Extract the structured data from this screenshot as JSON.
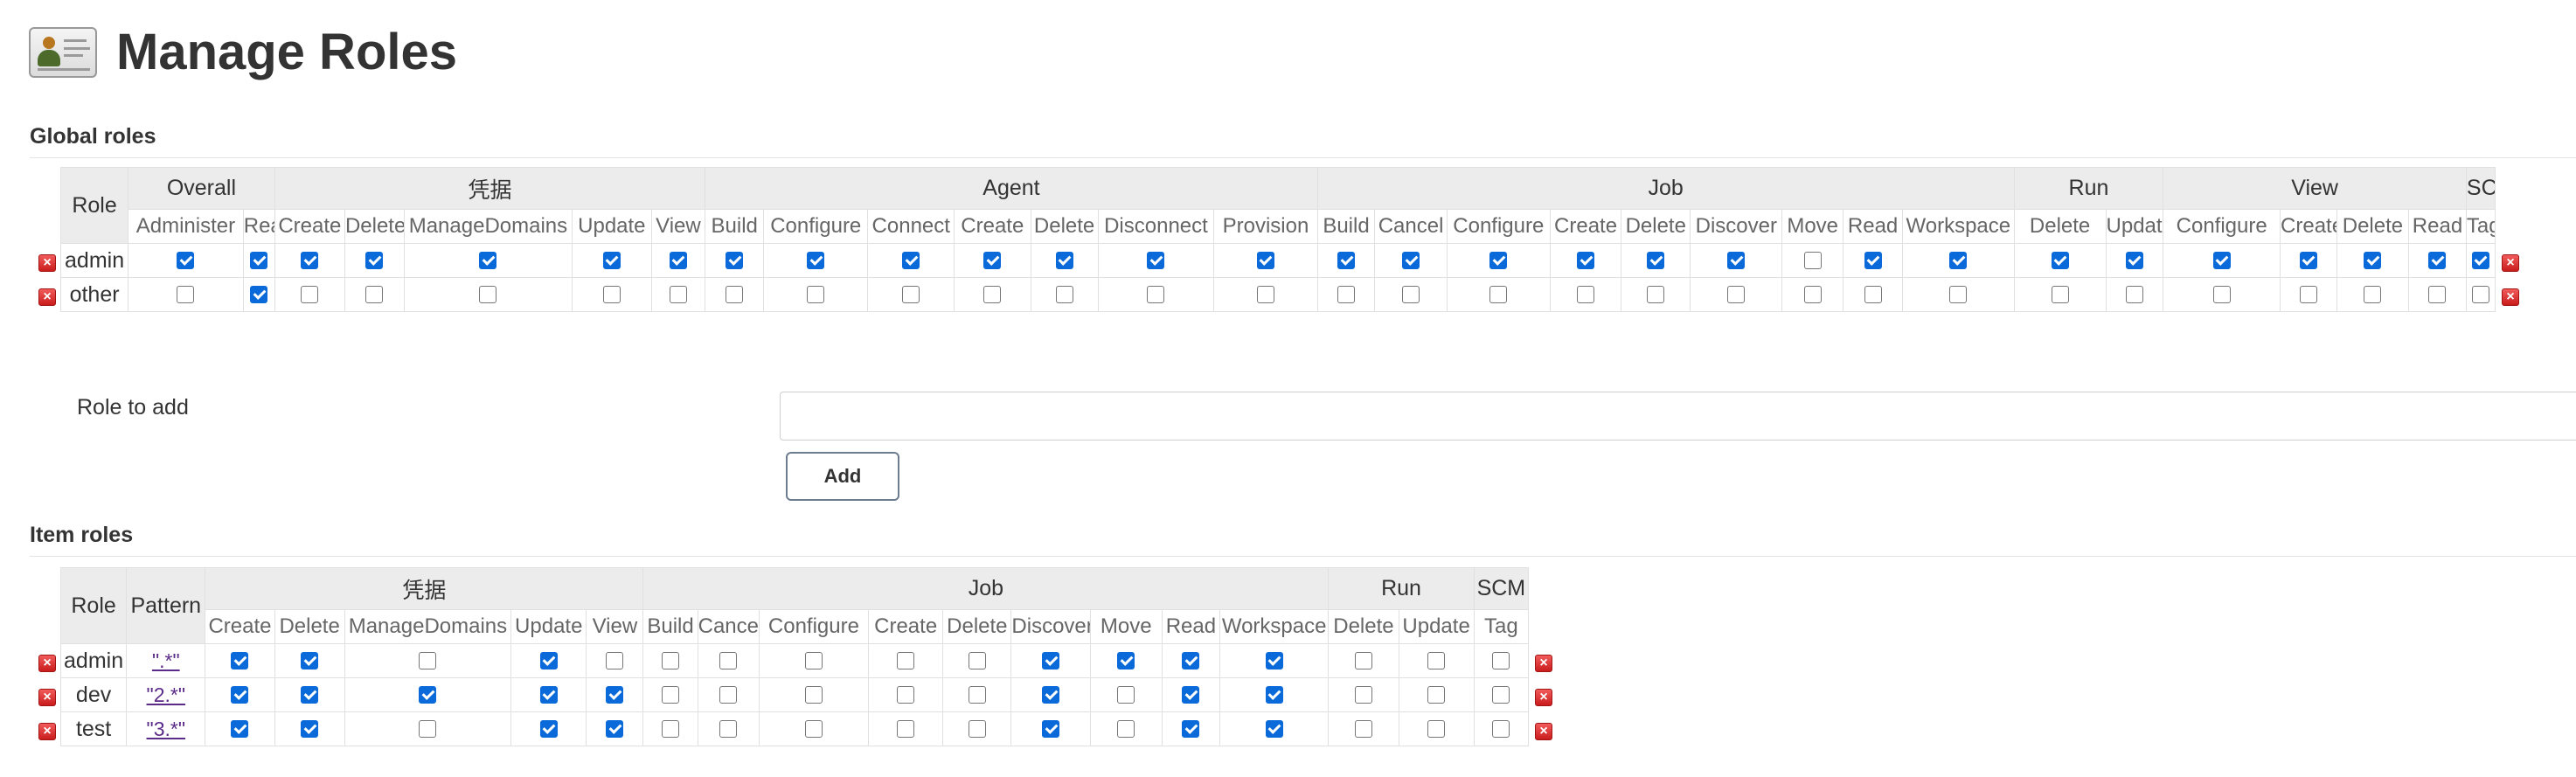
{
  "page": {
    "title": "Manage Roles"
  },
  "global": {
    "section_title": "Global roles",
    "role_header": "Role",
    "groups": [
      {
        "name": "Overall",
        "span": 2
      },
      {
        "name": "凭据",
        "span": 5
      },
      {
        "name": "Agent",
        "span": 7
      },
      {
        "name": "Job",
        "span": 9
      },
      {
        "name": "Run",
        "span": 2
      },
      {
        "name": "View",
        "span": 4
      },
      {
        "name": "SCM",
        "span": 1
      }
    ],
    "permissions": [
      "Administer",
      "Read",
      "Create",
      "Delete",
      "ManageDomains",
      "Update",
      "View",
      "Build",
      "Configure",
      "Connect",
      "Create",
      "Delete",
      "Disconnect",
      "Provision",
      "Build",
      "Cancel",
      "Configure",
      "Create",
      "Delete",
      "Discover",
      "Move",
      "Read",
      "Workspace",
      "Delete",
      "Update",
      "Configure",
      "Create",
      "Delete",
      "Read",
      "Tag"
    ],
    "roles": [
      {
        "name": "admin",
        "checked": [
          1,
          1,
          1,
          1,
          1,
          1,
          1,
          1,
          1,
          1,
          1,
          1,
          1,
          1,
          1,
          1,
          1,
          1,
          1,
          1,
          0,
          1,
          1,
          1,
          1,
          1,
          1,
          1,
          1,
          1
        ]
      },
      {
        "name": "other",
        "checked": [
          0,
          1,
          0,
          0,
          0,
          0,
          0,
          0,
          0,
          0,
          0,
          0,
          0,
          0,
          0,
          0,
          0,
          0,
          0,
          0,
          0,
          0,
          0,
          0,
          0,
          0,
          0,
          0,
          0,
          0
        ]
      }
    ]
  },
  "add_role": {
    "label": "Role to add",
    "input_value": "",
    "button_label": "Add"
  },
  "item": {
    "section_title": "Item roles",
    "role_header": "Role",
    "pattern_header": "Pattern",
    "groups": [
      {
        "name": "凭据",
        "span": 5
      },
      {
        "name": "Job",
        "span": 9
      },
      {
        "name": "Run",
        "span": 2
      },
      {
        "name": "SCM",
        "span": 1
      }
    ],
    "permissions": [
      "Create",
      "Delete",
      "ManageDomains",
      "Update",
      "View",
      "Build",
      "Cancel",
      "Configure",
      "Create",
      "Delete",
      "Discover",
      "Move",
      "Read",
      "Workspace",
      "Delete",
      "Update",
      "Tag"
    ],
    "roles": [
      {
        "name": "admin",
        "pattern": "\".*\"",
        "checked": [
          1,
          1,
          0,
          1,
          0,
          0,
          0,
          0,
          0,
          0,
          1,
          1,
          1,
          1,
          0,
          0,
          0
        ]
      },
      {
        "name": "dev",
        "pattern": "\"2.*\"",
        "checked": [
          1,
          1,
          1,
          1,
          1,
          0,
          0,
          0,
          0,
          0,
          1,
          0,
          1,
          1,
          0,
          0,
          0
        ]
      },
      {
        "name": "test",
        "pattern": "\"3.*\"",
        "checked": [
          1,
          1,
          0,
          1,
          1,
          0,
          0,
          0,
          0,
          0,
          1,
          0,
          1,
          1,
          0,
          0,
          0
        ]
      }
    ]
  },
  "icons": {
    "delete": "delete-icon",
    "logo": "role-card-icon"
  },
  "colors": {
    "checkbox_checked": "#0b6ad9",
    "delete_icon": "#d93030",
    "header_bg": "#ececec",
    "pattern_link": "#5b2b8a"
  }
}
